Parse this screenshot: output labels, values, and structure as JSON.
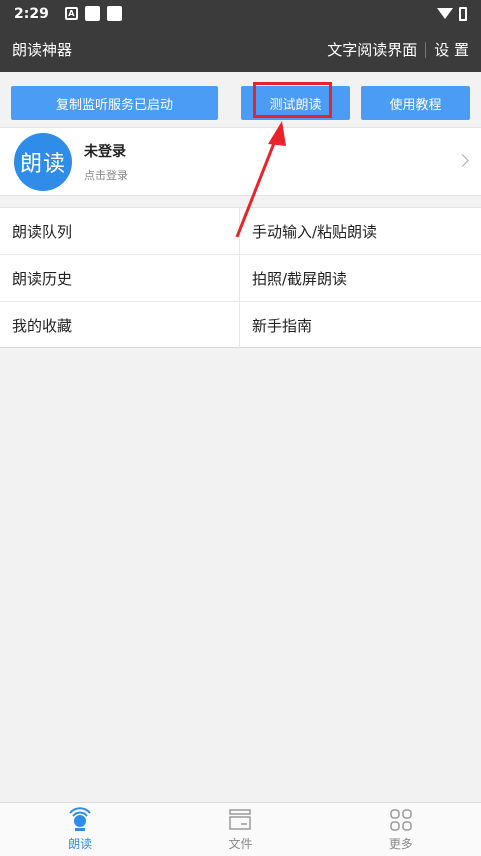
{
  "status_bar": {
    "time": "2:29",
    "notification_icon_letter": "A",
    "icons": [
      "notification-a-icon",
      "square-icon",
      "square-icon",
      "wifi-icon",
      "battery-icon"
    ]
  },
  "title_bar": {
    "app_title": "朗读神器",
    "reading_ui_link": "文字阅读界面",
    "settings_link": "设 置"
  },
  "buttons": {
    "copy_listen": "复制监听服务已启动",
    "test_read": "测试朗读",
    "tutorial": "使用教程"
  },
  "user_card": {
    "avatar_text": "朗读",
    "name": "未登录",
    "subtitle": "点击登录"
  },
  "menu": {
    "items": [
      "朗读队列",
      "手动输入/粘贴朗读",
      "朗读历史",
      "拍照/截屏朗读",
      "我的收藏",
      "新手指南"
    ]
  },
  "bottom_nav": {
    "items": [
      {
        "label": "朗读",
        "icon": "read-aloud-icon",
        "active": true
      },
      {
        "label": "文件",
        "icon": "file-icon",
        "active": false
      },
      {
        "label": "更多",
        "icon": "more-grid-icon",
        "active": false
      }
    ]
  },
  "colors": {
    "accent": "#4a9cf5",
    "header": "#3b3b3b",
    "highlight": "#e8232a",
    "avatar": "#2f8ce8"
  }
}
